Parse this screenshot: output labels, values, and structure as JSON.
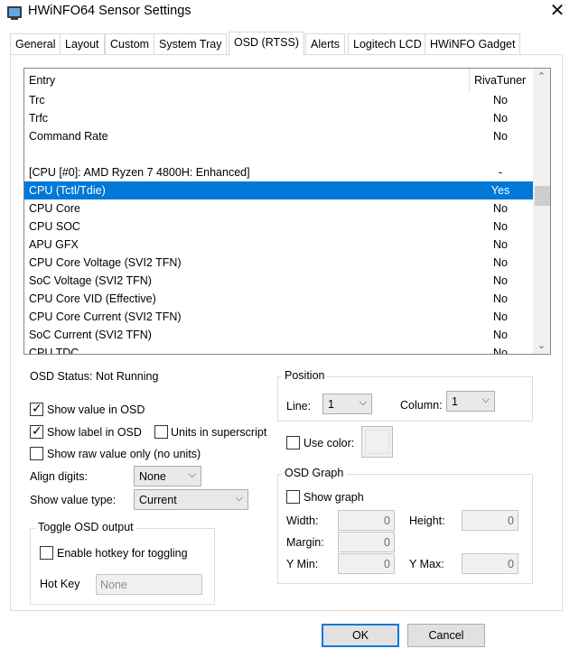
{
  "window": {
    "title": "HWiNFO64 Sensor Settings",
    "close_glyph": "✕",
    "icon": "hwinfo-app-icon"
  },
  "tabs": [
    {
      "label": "General"
    },
    {
      "label": "Layout"
    },
    {
      "label": "Custom"
    },
    {
      "label": "System Tray"
    },
    {
      "label": "OSD (RTSS)"
    },
    {
      "label": "Alerts"
    },
    {
      "label": "Logitech LCD"
    },
    {
      "label": "HWiNFO Gadget"
    }
  ],
  "active_tab": "OSD (RTSS)",
  "list": {
    "col_entry": "Entry",
    "col_rivatuner": "RivaTuner",
    "rows": [
      {
        "entry": "Trc",
        "value": "No"
      },
      {
        "entry": "Trfc",
        "value": "No"
      },
      {
        "entry": "Command Rate",
        "value": "No"
      },
      {
        "entry": "",
        "value": ""
      },
      {
        "entry": "[CPU [#0]: AMD Ryzen 7 4800H: Enhanced]",
        "value": "-"
      },
      {
        "entry": "CPU (Tctl/Tdie)",
        "value": "Yes",
        "selected": true
      },
      {
        "entry": "CPU Core",
        "value": "No"
      },
      {
        "entry": "CPU SOC",
        "value": "No"
      },
      {
        "entry": "APU GFX",
        "value": "No"
      },
      {
        "entry": "CPU Core Voltage (SVI2 TFN)",
        "value": "No"
      },
      {
        "entry": "SoC Voltage (SVI2 TFN)",
        "value": "No"
      },
      {
        "entry": "CPU Core VID (Effective)",
        "value": "No"
      },
      {
        "entry": "CPU Core Current (SVI2 TFN)",
        "value": "No"
      },
      {
        "entry": "SoC Current (SVI2 TFN)",
        "value": "No"
      },
      {
        "entry": "CPU TDC",
        "value": "No"
      }
    ],
    "selection_color": "#0078d7"
  },
  "osd": {
    "status": "OSD Status: Not Running",
    "show_value": {
      "label": "Show value in OSD",
      "checked": true
    },
    "show_label": {
      "label": "Show label in OSD",
      "checked": true
    },
    "units_superscript": {
      "label": "Units in superscript",
      "checked": false
    },
    "show_raw": {
      "label": "Show raw value only (no units)",
      "checked": false
    },
    "align_digits": {
      "label": "Align digits:",
      "value": "None"
    },
    "show_value_type": {
      "label": "Show value type:",
      "value": "Current"
    },
    "toggle_group": {
      "title": "Toggle OSD output",
      "enable_hotkey": {
        "label": "Enable hotkey for toggling",
        "checked": false
      },
      "hotkey_label": "Hot Key",
      "hotkey_value": "None"
    }
  },
  "position": {
    "title": "Position",
    "line_label": "Line:",
    "line_value": "1",
    "column_label": "Column:",
    "column_value": "1"
  },
  "use_color": {
    "label": "Use color:",
    "checked": false
  },
  "graph": {
    "title": "OSD Graph",
    "show_graph": {
      "label": "Show graph",
      "checked": false
    },
    "width_label": "Width:",
    "width_value": "0",
    "height_label": "Height:",
    "height_value": "0",
    "margin_label": "Margin:",
    "margin_value": "0",
    "ymin_label": "Y Min:",
    "ymin_value": "0",
    "ymax_label": "Y Max:",
    "ymax_value": "0"
  },
  "buttons": {
    "ok": "OK",
    "cancel": "Cancel"
  },
  "check_glyph": "✓",
  "dropdown_glyph": "⌵",
  "scroll_up_glyph": "⌃",
  "scroll_down_glyph": "⌄"
}
